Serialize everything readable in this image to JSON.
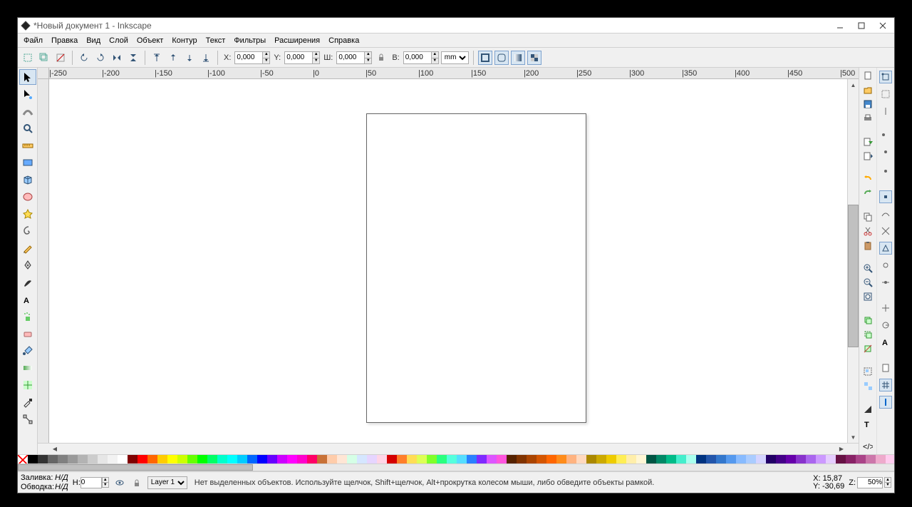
{
  "title": "*Новый документ 1 - Inkscape",
  "menu": [
    "Файл",
    "Правка",
    "Вид",
    "Слой",
    "Объект",
    "Контур",
    "Текст",
    "Фильтры",
    "Расширения",
    "Справка"
  ],
  "coords": {
    "xLabel": "X:",
    "x": "0,000",
    "yLabel": "Y:",
    "y": "0,000",
    "wLabel": "Ш:",
    "w": "0,000",
    "hLabel": "В:",
    "h": "0,000",
    "unit": "mm"
  },
  "palette": [
    "none",
    "#000000",
    "#333333",
    "#666666",
    "#808080",
    "#999999",
    "#b3b3b3",
    "#cccccc",
    "#e6e6e6",
    "#f2f2f2",
    "#ffffff",
    "#800000",
    "#ff0000",
    "#ff6600",
    "#ffcc00",
    "#ffff00",
    "#ccff00",
    "#66ff00",
    "#00ff00",
    "#00ff66",
    "#00ffcc",
    "#00ffff",
    "#00ccff",
    "#0066ff",
    "#0000ff",
    "#6600ff",
    "#cc00ff",
    "#ff00ff",
    "#ff00cc",
    "#ff0066",
    "#c87137",
    "#ffccaa",
    "#ffe6d5",
    "#d5ffe6",
    "#d5e6ff",
    "#e6d5ff",
    "#ffd5e6",
    "#d40000",
    "#ff7f2a",
    "#ffdd55",
    "#ddff55",
    "#7fff2a",
    "#2aff7f",
    "#55ffdd",
    "#55ddff",
    "#2a7fff",
    "#7f2aff",
    "#dd55ff",
    "#ff55dd",
    "#552200",
    "#803300",
    "#aa4400",
    "#d45500",
    "#ff6600",
    "#ff8c1a",
    "#ffb380",
    "#ffd9bf",
    "#aa8800",
    "#ccaa00",
    "#eecc00",
    "#ffee55",
    "#ffeeaa",
    "#fff6d5",
    "#005544",
    "#008866",
    "#00bb88",
    "#44eecc",
    "#aaffee",
    "#003380",
    "#2255aa",
    "#3377cc",
    "#5599ee",
    "#88bbff",
    "#aaccff",
    "#d4d4ff",
    "#220066",
    "#440088",
    "#6600aa",
    "#8833cc",
    "#aa66ee",
    "#cc99ff",
    "#e5ccff",
    "#661144",
    "#882266",
    "#aa4488",
    "#cc77aa",
    "#eeaacc",
    "#ffccee",
    "#aacc00",
    "#ccee00"
  ],
  "status": {
    "fillLabel": "Заливка:",
    "fillVal": "Н/Д",
    "strokeLabel": "Обводка:",
    "strokeVal": "Н/Д",
    "opacityLabel": "Н:",
    "opacity": "0",
    "layer": "Layer 1",
    "msg": "Нет выделенных объектов. Используйте щелчок, Shift+щелчок, Alt+прокрутка колесом мыши, либо обведите объекты рамкой.",
    "coordXLabel": "X:",
    "coordX": "15,87",
    "coordYLabel": "Y:",
    "coordY": "-30,69",
    "zoomLabel": "Z:",
    "zoom": "50%"
  }
}
